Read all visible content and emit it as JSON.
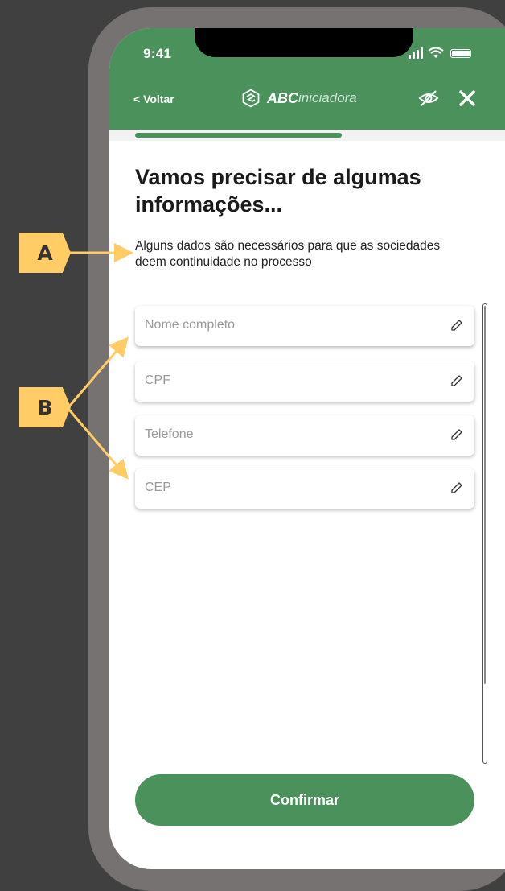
{
  "status_bar": {
    "time": "9:41"
  },
  "nav": {
    "back_label": "< Voltar",
    "brand_bold": "ABC",
    "brand_light": "iniciadora"
  },
  "progress": {
    "fraction": 0.6
  },
  "content": {
    "title": "Vamos precisar de algumas informações...",
    "subtitle": "Alguns dados são necessários para que as sociedades deem continuidade no processo"
  },
  "fields": [
    {
      "placeholder": "Nome completo"
    },
    {
      "placeholder": "CPF"
    },
    {
      "placeholder": "Telefone"
    },
    {
      "placeholder": "CEP"
    }
  ],
  "confirm_label": "Confirmar",
  "annotations": {
    "a": "A",
    "b": "B"
  },
  "colors": {
    "primary_green": "#4a915c",
    "annotation_yellow": "#ffcc66",
    "background": "#404040"
  }
}
